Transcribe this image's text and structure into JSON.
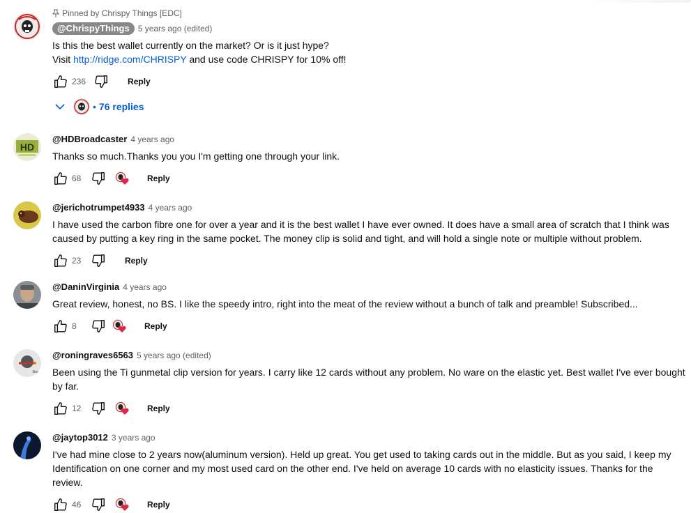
{
  "comments": [
    {
      "pinned_label": "Pinned by Chrispy Things [EDC]",
      "author": "@ChrispyThings",
      "time": "5 years ago (edited)",
      "text_line1": "Is this the best wallet currently on the market? Or is it just hype?",
      "text_prefix": "Visit ",
      "link": "http://ridge.com/CHRISPY",
      "text_suffix": " and use code CHRISPY for 10% off!",
      "likes": "236",
      "reply_label": "Reply",
      "replies_label": "76 replies",
      "avatar_icon": "chrispy-skull-logo"
    },
    {
      "author": "@HDBroadcaster",
      "time": "4 years ago",
      "text": "Thanks so much.Thanks you you I'm getting one through your link.",
      "likes": "68",
      "reply_label": "Reply",
      "avatar_icon": "hd-logo"
    },
    {
      "author": "@jerichotrumpet4933",
      "time": "4 years ago",
      "text": "I have used the carbon fibre one for over a year and it is the best wallet I have ever owned. It does have a small area of scratch that I think was caused by putting a key ring in the same pocket. The money clip is solid and tight, and will hold a single note or multiple without problem.",
      "likes": "23",
      "reply_label": "Reply",
      "avatar_icon": "animal-photo"
    },
    {
      "author": "@DaninVirginia",
      "time": "4 years ago",
      "text": "Great review, honest, no BS. I like the speedy intro, right into the meat of the review without a bunch of talk and preamble! Subscribed...",
      "likes": "8",
      "reply_label": "Reply",
      "avatar_icon": "person-photo"
    },
    {
      "author": "@roningraves6563",
      "time": "5 years ago (edited)",
      "text": "Been using the Ti gunmetal clip version for years. I carry like 12 cards without any problem. No ware on the elastic yet. Best wallet I've ever bought by far.",
      "likes": "12",
      "reply_label": "Reply",
      "avatar_icon": "cigar-logo"
    },
    {
      "author": "@jaytop3012",
      "time": "3 years ago",
      "text": "I've had mine close to 2 years now(aluminum version). Held up great. You get used to taking cards out in the middle. But as you said, I keep my Identification on one corner and my most used card on the other end. I've held on average 10 cards with no elasticity issues. Thanks for the review.",
      "likes": "46",
      "reply_label": "Reply",
      "avatar_icon": "dark-figure-photo"
    }
  ],
  "colors": {
    "link": "#065fd4",
    "meta": "#606060",
    "heart": "#e0244a",
    "author_pill": "#888888"
  }
}
